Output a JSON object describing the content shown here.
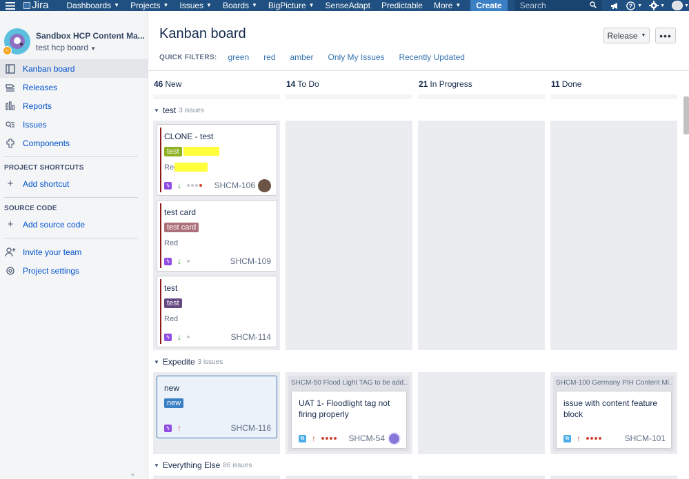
{
  "topnav": {
    "logo": "Jira",
    "items": [
      {
        "label": "Dashboards",
        "caret": true
      },
      {
        "label": "Projects",
        "caret": true
      },
      {
        "label": "Issues",
        "caret": true
      },
      {
        "label": "Boards",
        "caret": true
      },
      {
        "label": "BigPicture",
        "caret": true
      },
      {
        "label": "SenseAdapt",
        "caret": false
      },
      {
        "label": "Predictable",
        "caret": false
      },
      {
        "label": "More",
        "caret": true
      }
    ],
    "create_label": "Create",
    "search_placeholder": "Search"
  },
  "sidebar": {
    "project_name": "Sandbox HCP Content Ma...",
    "board_name": "test hcp board",
    "nav": [
      {
        "label": "Kanban board",
        "icon": "board-icon",
        "active": true
      },
      {
        "label": "Releases",
        "icon": "releases-icon",
        "active": false
      },
      {
        "label": "Reports",
        "icon": "reports-icon",
        "active": false
      },
      {
        "label": "Issues",
        "icon": "issues-icon",
        "active": false
      },
      {
        "label": "Components",
        "icon": "components-icon",
        "active": false
      }
    ],
    "shortcuts_title": "PROJECT SHORTCUTS",
    "add_shortcut": "Add shortcut",
    "source_title": "SOURCE CODE",
    "add_source": "Add source code",
    "invite": "Invite your team",
    "settings": "Project settings"
  },
  "main": {
    "title": "Kanban board",
    "release_label": "Release",
    "more_label": "•••",
    "filters_label": "QUICK FILTERS:",
    "filters": [
      "green",
      "red",
      "amber",
      "Only My Issues",
      "Recently Updated"
    ],
    "columns": [
      {
        "count": "46",
        "name": "New"
      },
      {
        "count": "14",
        "name": "To Do"
      },
      {
        "count": "21",
        "name": "In Progress"
      },
      {
        "count": "11",
        "name": "Done"
      }
    ]
  },
  "swimlanes": {
    "test": {
      "name": "test",
      "count": "3 issues"
    },
    "expedite": {
      "name": "Expedite",
      "count": "3 issues"
    },
    "else": {
      "name": "Everything Else",
      "count": "86 issues"
    }
  },
  "cards": {
    "c106": {
      "title": "CLONE - test",
      "label": "test",
      "sub": "Red",
      "key": "SHCM-106"
    },
    "c109": {
      "title": "test card",
      "label": "test card",
      "sub": "Red",
      "key": "SHCM-109"
    },
    "c114": {
      "title": "test",
      "label": "test",
      "sub": "Red",
      "key": "SHCM-114"
    },
    "c116": {
      "title": "new",
      "label": "new",
      "key": "SHCM-116"
    },
    "c54": {
      "parent": "SHCM-50 Flood Light TAG to be add...",
      "title1": "UAT 1- Floodlight tag not",
      "title2": "firing properly",
      "key": "SHCM-54"
    },
    "c101": {
      "parent": "SHCM-100 Germany PIH Content Mi...",
      "title1": "issue with content feature",
      "title2": "block",
      "key": "SHCM-101"
    }
  },
  "colors": {
    "nav_bg": "#205081",
    "label_green": "#8eb021",
    "label_red": "#ac707a",
    "label_purple": "#654982",
    "label_blue": "#3b7fc4",
    "highlight": "#ffff3c"
  }
}
